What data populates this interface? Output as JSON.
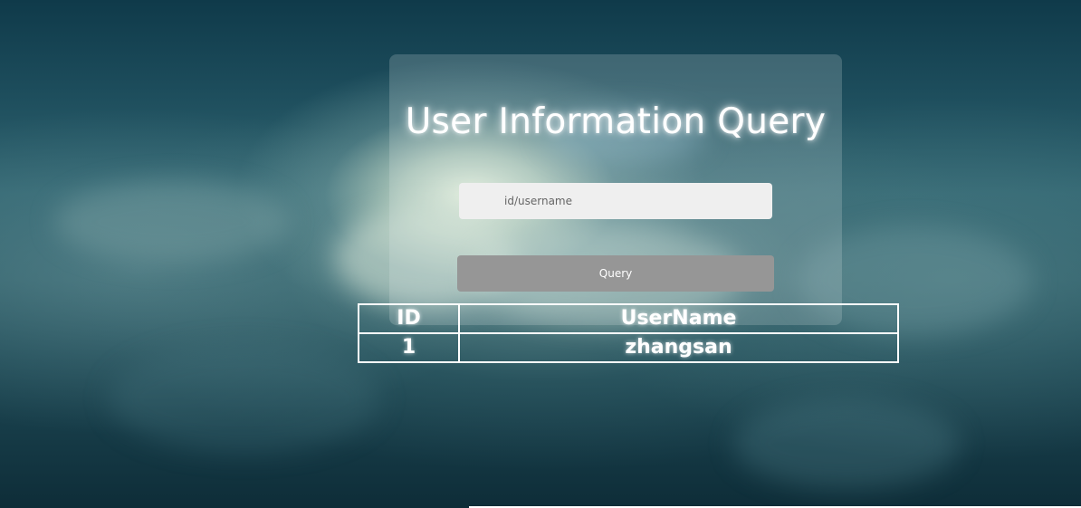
{
  "page": {
    "title": "User Information Query"
  },
  "search": {
    "placeholder": "id/username",
    "value": ""
  },
  "actions": {
    "query_label": "Query"
  },
  "table": {
    "headers": {
      "id": "ID",
      "username": "UserName"
    },
    "rows": [
      {
        "id": "1",
        "username": "zhangsan"
      }
    ]
  },
  "colors": {
    "panel_overlay": "rgba(225,235,235,0.2)",
    "input_background": "#efefef",
    "button_background": "#969696",
    "text": "#ffffff"
  }
}
